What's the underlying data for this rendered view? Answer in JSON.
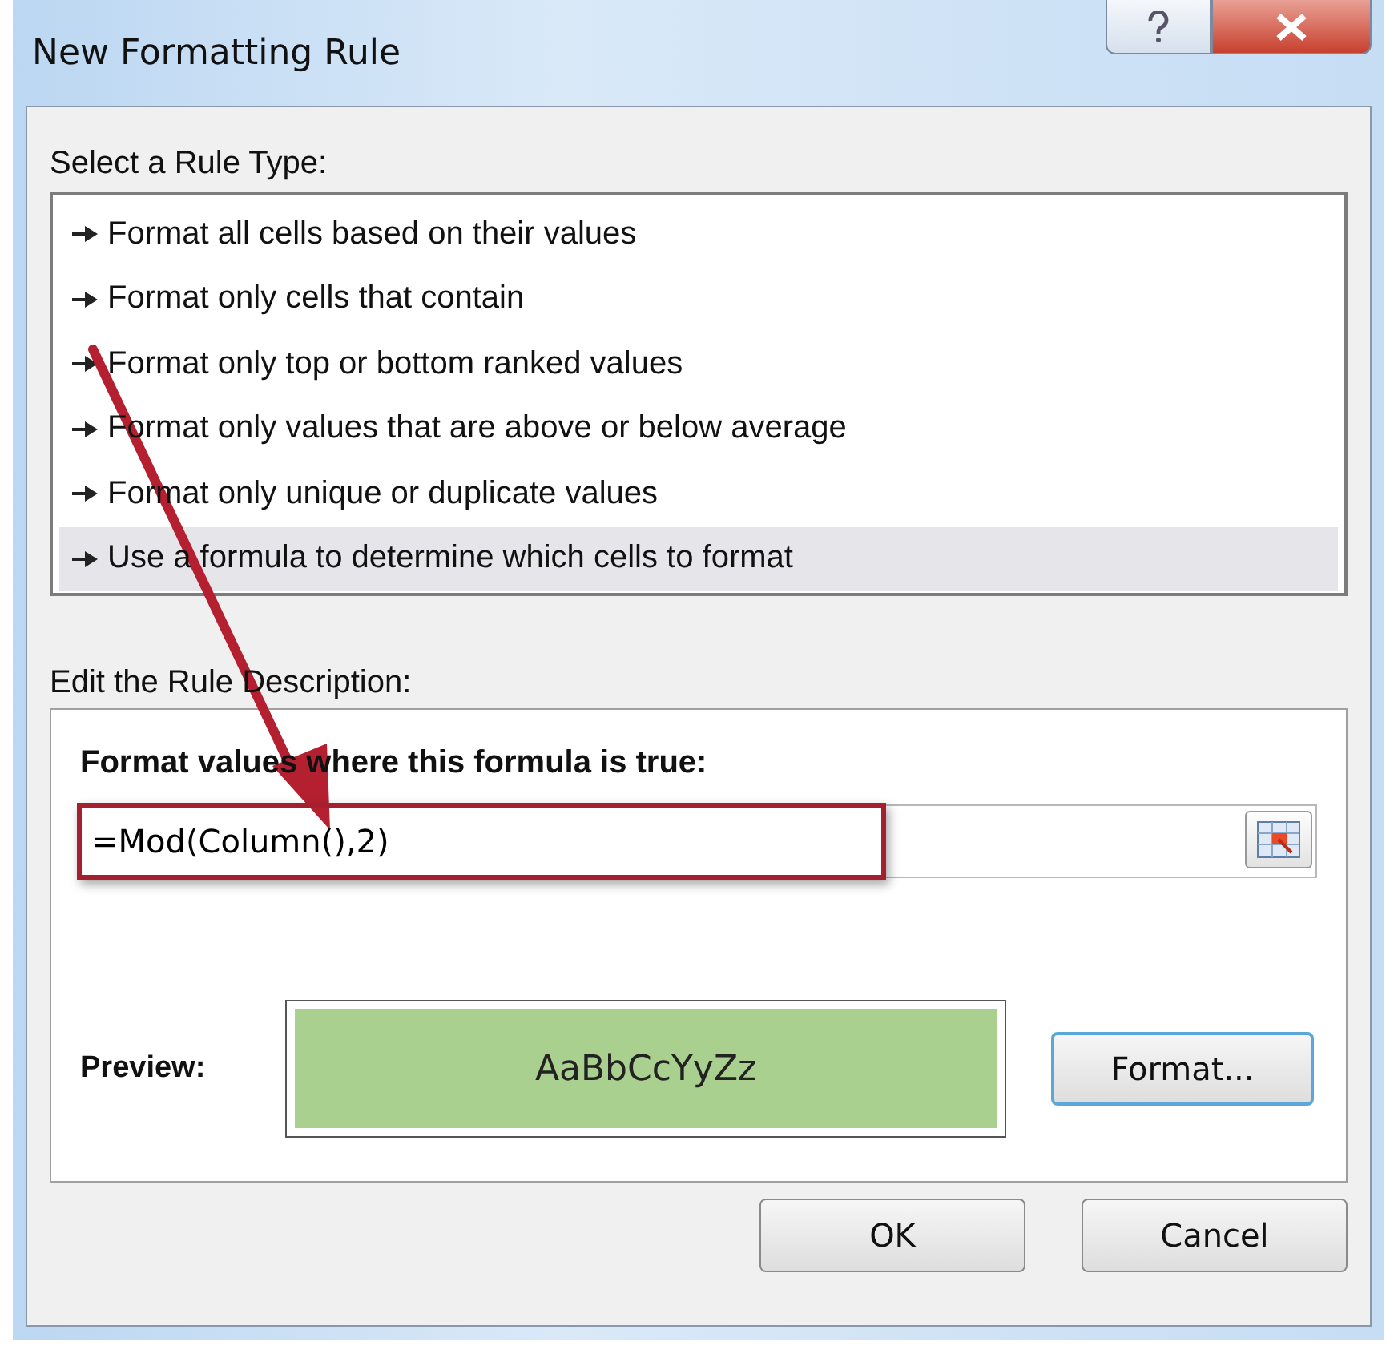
{
  "window": {
    "title": "New Formatting Rule"
  },
  "rule_types": {
    "label": "Select a Rule Type:",
    "items": [
      {
        "text": "Format all cells based on their values",
        "selected": false
      },
      {
        "text": "Format only cells that contain",
        "selected": false
      },
      {
        "text": "Format only top or bottom ranked values",
        "selected": false
      },
      {
        "text": "Format only values that are above or below average",
        "selected": false
      },
      {
        "text": "Format only unique or duplicate values",
        "selected": false
      },
      {
        "text": "Use a formula to determine which cells to format",
        "selected": true
      }
    ]
  },
  "description": {
    "label": "Edit the Rule Description:",
    "formula_label": "Format values where this formula is true:",
    "formula": {
      "value": "=Mod(Column(),2)"
    },
    "preview_label": "Preview:",
    "preview_text": "AaBbCcYyZz",
    "format_button": "Format..."
  },
  "buttons": [
    "OK",
    "Cancel"
  ]
}
